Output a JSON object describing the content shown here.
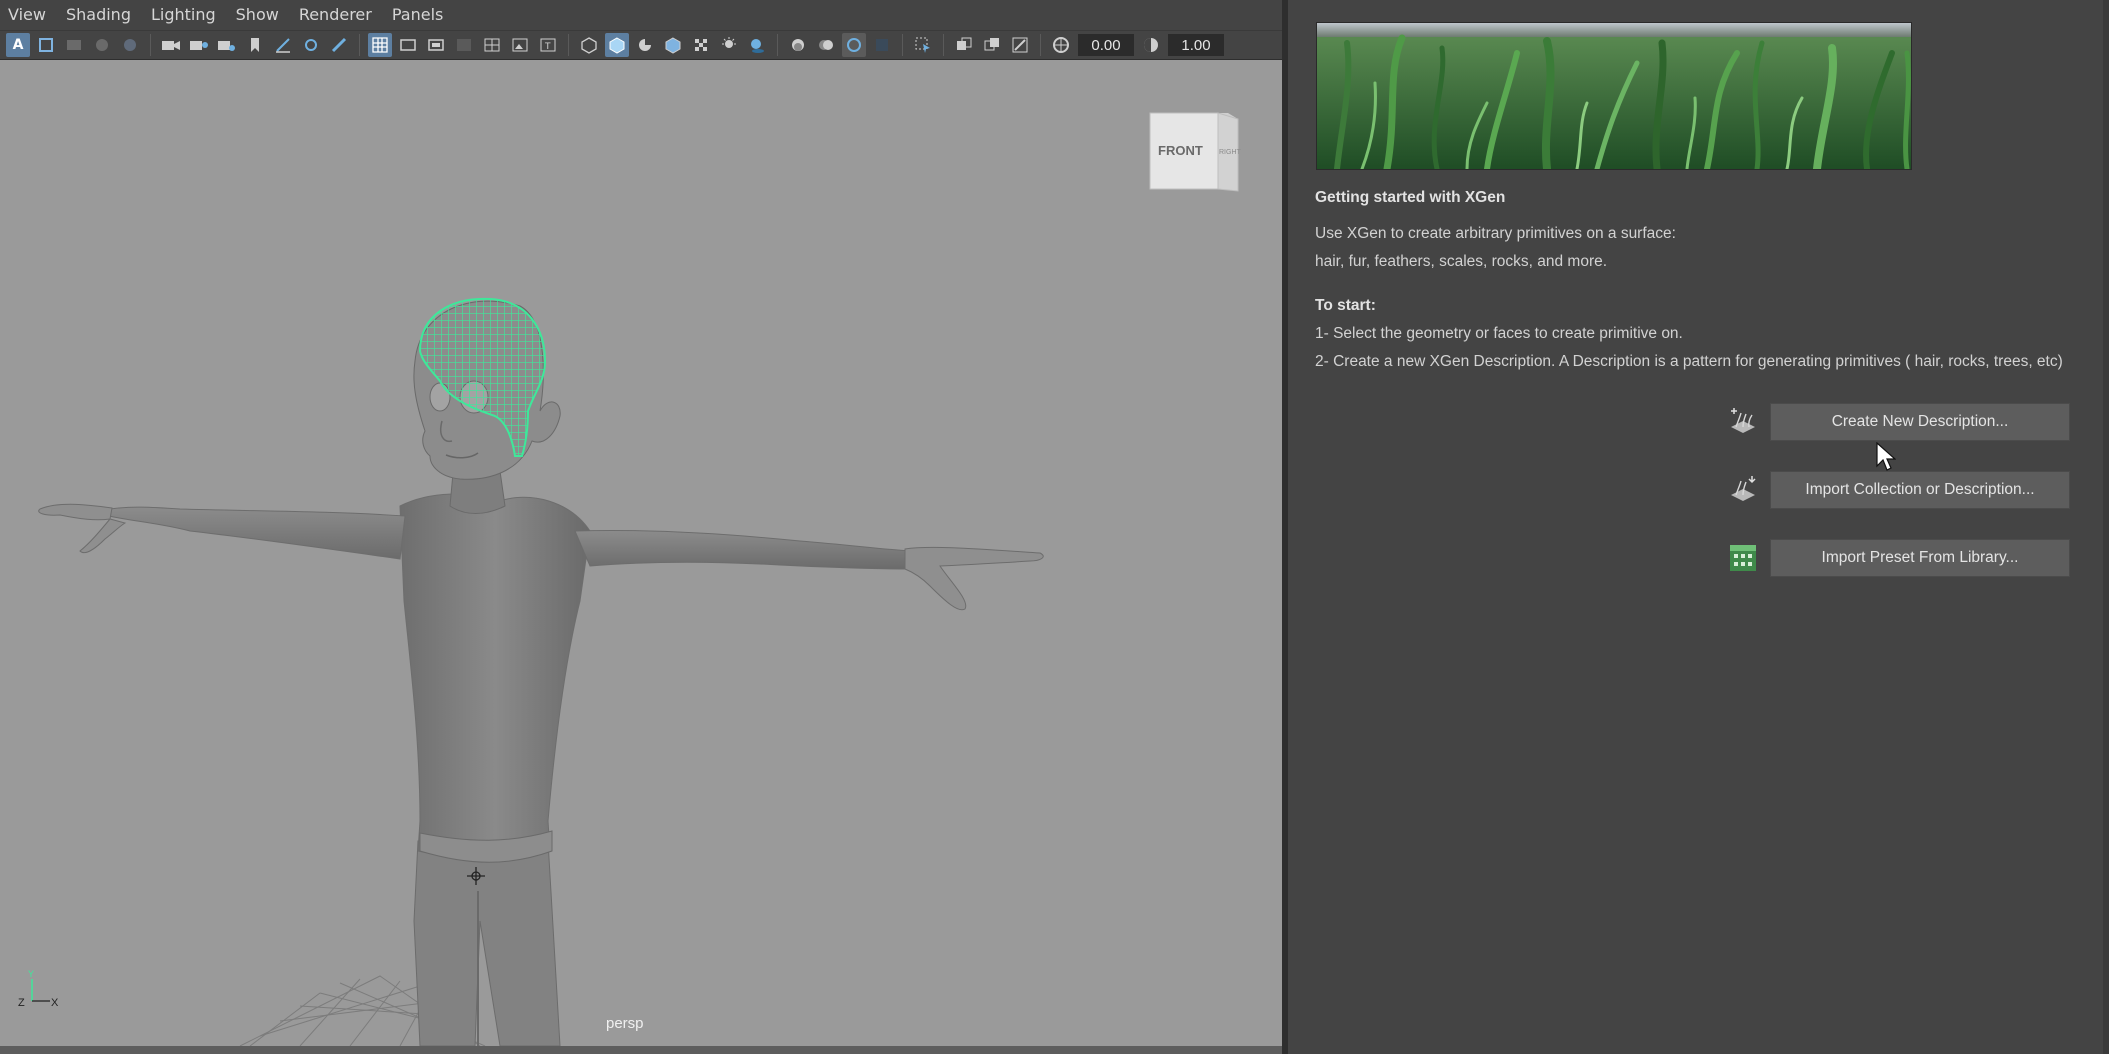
{
  "menubar": {
    "items": [
      "View",
      "Shading",
      "Lighting",
      "Show",
      "Renderer",
      "Panels"
    ]
  },
  "toolbar": {
    "exposure_value": "0.00",
    "gamma_value": "1.00"
  },
  "viewport": {
    "camera_label": "persp",
    "view_cube_front": "FRONT",
    "view_cube_right": "RIGHT",
    "axis_y": "Y",
    "axis_x": "X",
    "axis_z": "Z",
    "background_color": "#9a9a9a",
    "selection_color": "#3ee89a"
  },
  "xgen": {
    "title": "Getting started with XGen",
    "intro_line1": "Use XGen to create arbitrary primitives on a surface:",
    "intro_line2": "hair, fur, feathers, scales, rocks, and more.",
    "start_heading": "To start:",
    "step1": "1- Select the geometry or faces to create primitive on.",
    "step2": "2- Create a new XGen Description. A Description is a pattern for generating primitives ( hair, rocks, trees, etc)",
    "buttons": {
      "create_new": "Create New Description...",
      "import_collection": "Import Collection or Description...",
      "import_preset": "Import Preset From Library..."
    }
  }
}
